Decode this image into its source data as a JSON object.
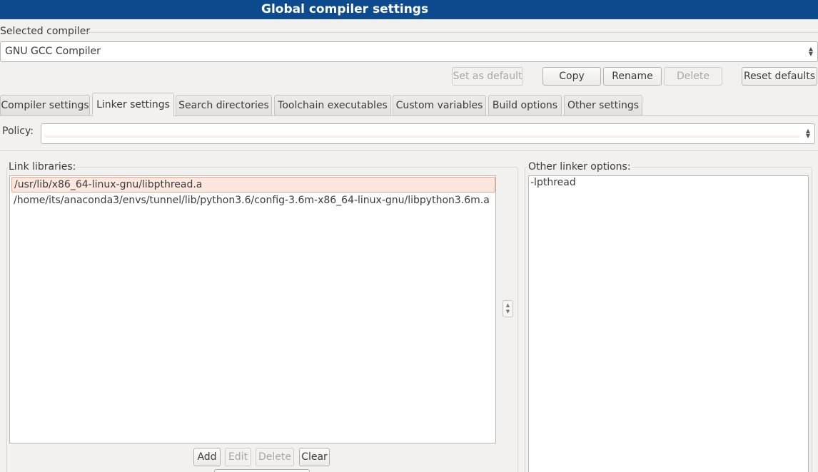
{
  "window": {
    "title": "Global compiler settings"
  },
  "selected_compiler": {
    "label": "Selected compiler",
    "value": "GNU GCC Compiler",
    "buttons": {
      "set_default": "Set as default",
      "copy": "Copy",
      "rename": "Rename",
      "delete": "Delete",
      "reset": "Reset defaults"
    }
  },
  "tabs": [
    {
      "label": "Compiler settings",
      "active": false
    },
    {
      "label": "Linker settings",
      "active": true
    },
    {
      "label": "Search directories",
      "active": false
    },
    {
      "label": "Toolchain executables",
      "active": false
    },
    {
      "label": "Custom variables",
      "active": false
    },
    {
      "label": "Build options",
      "active": false
    },
    {
      "label": "Other settings",
      "active": false
    }
  ],
  "policy": {
    "label": "Policy:",
    "value": ""
  },
  "link_libraries": {
    "title": "Link libraries:",
    "items": [
      "/usr/lib/x86_64-linux-gnu/libpthread.a",
      "/home/its/anaconda3/envs/tunnel/lib/python3.6/config-3.6m-x86_64-linux-gnu/libpython3.6m.a"
    ],
    "selected_index": 0,
    "buttons": {
      "add": "Add",
      "edit": "Edit",
      "delete": "Delete",
      "clear": "Clear"
    }
  },
  "other_linker_options": {
    "title": "Other linker options:",
    "value": "-lpthread"
  },
  "icons": {
    "spin_up": "triangle-up",
    "spin_down": "triangle-down"
  },
  "colors": {
    "titlebar": "#0e4a8e",
    "selection": "#fbe7de",
    "selection_border": "#e9a78c"
  }
}
